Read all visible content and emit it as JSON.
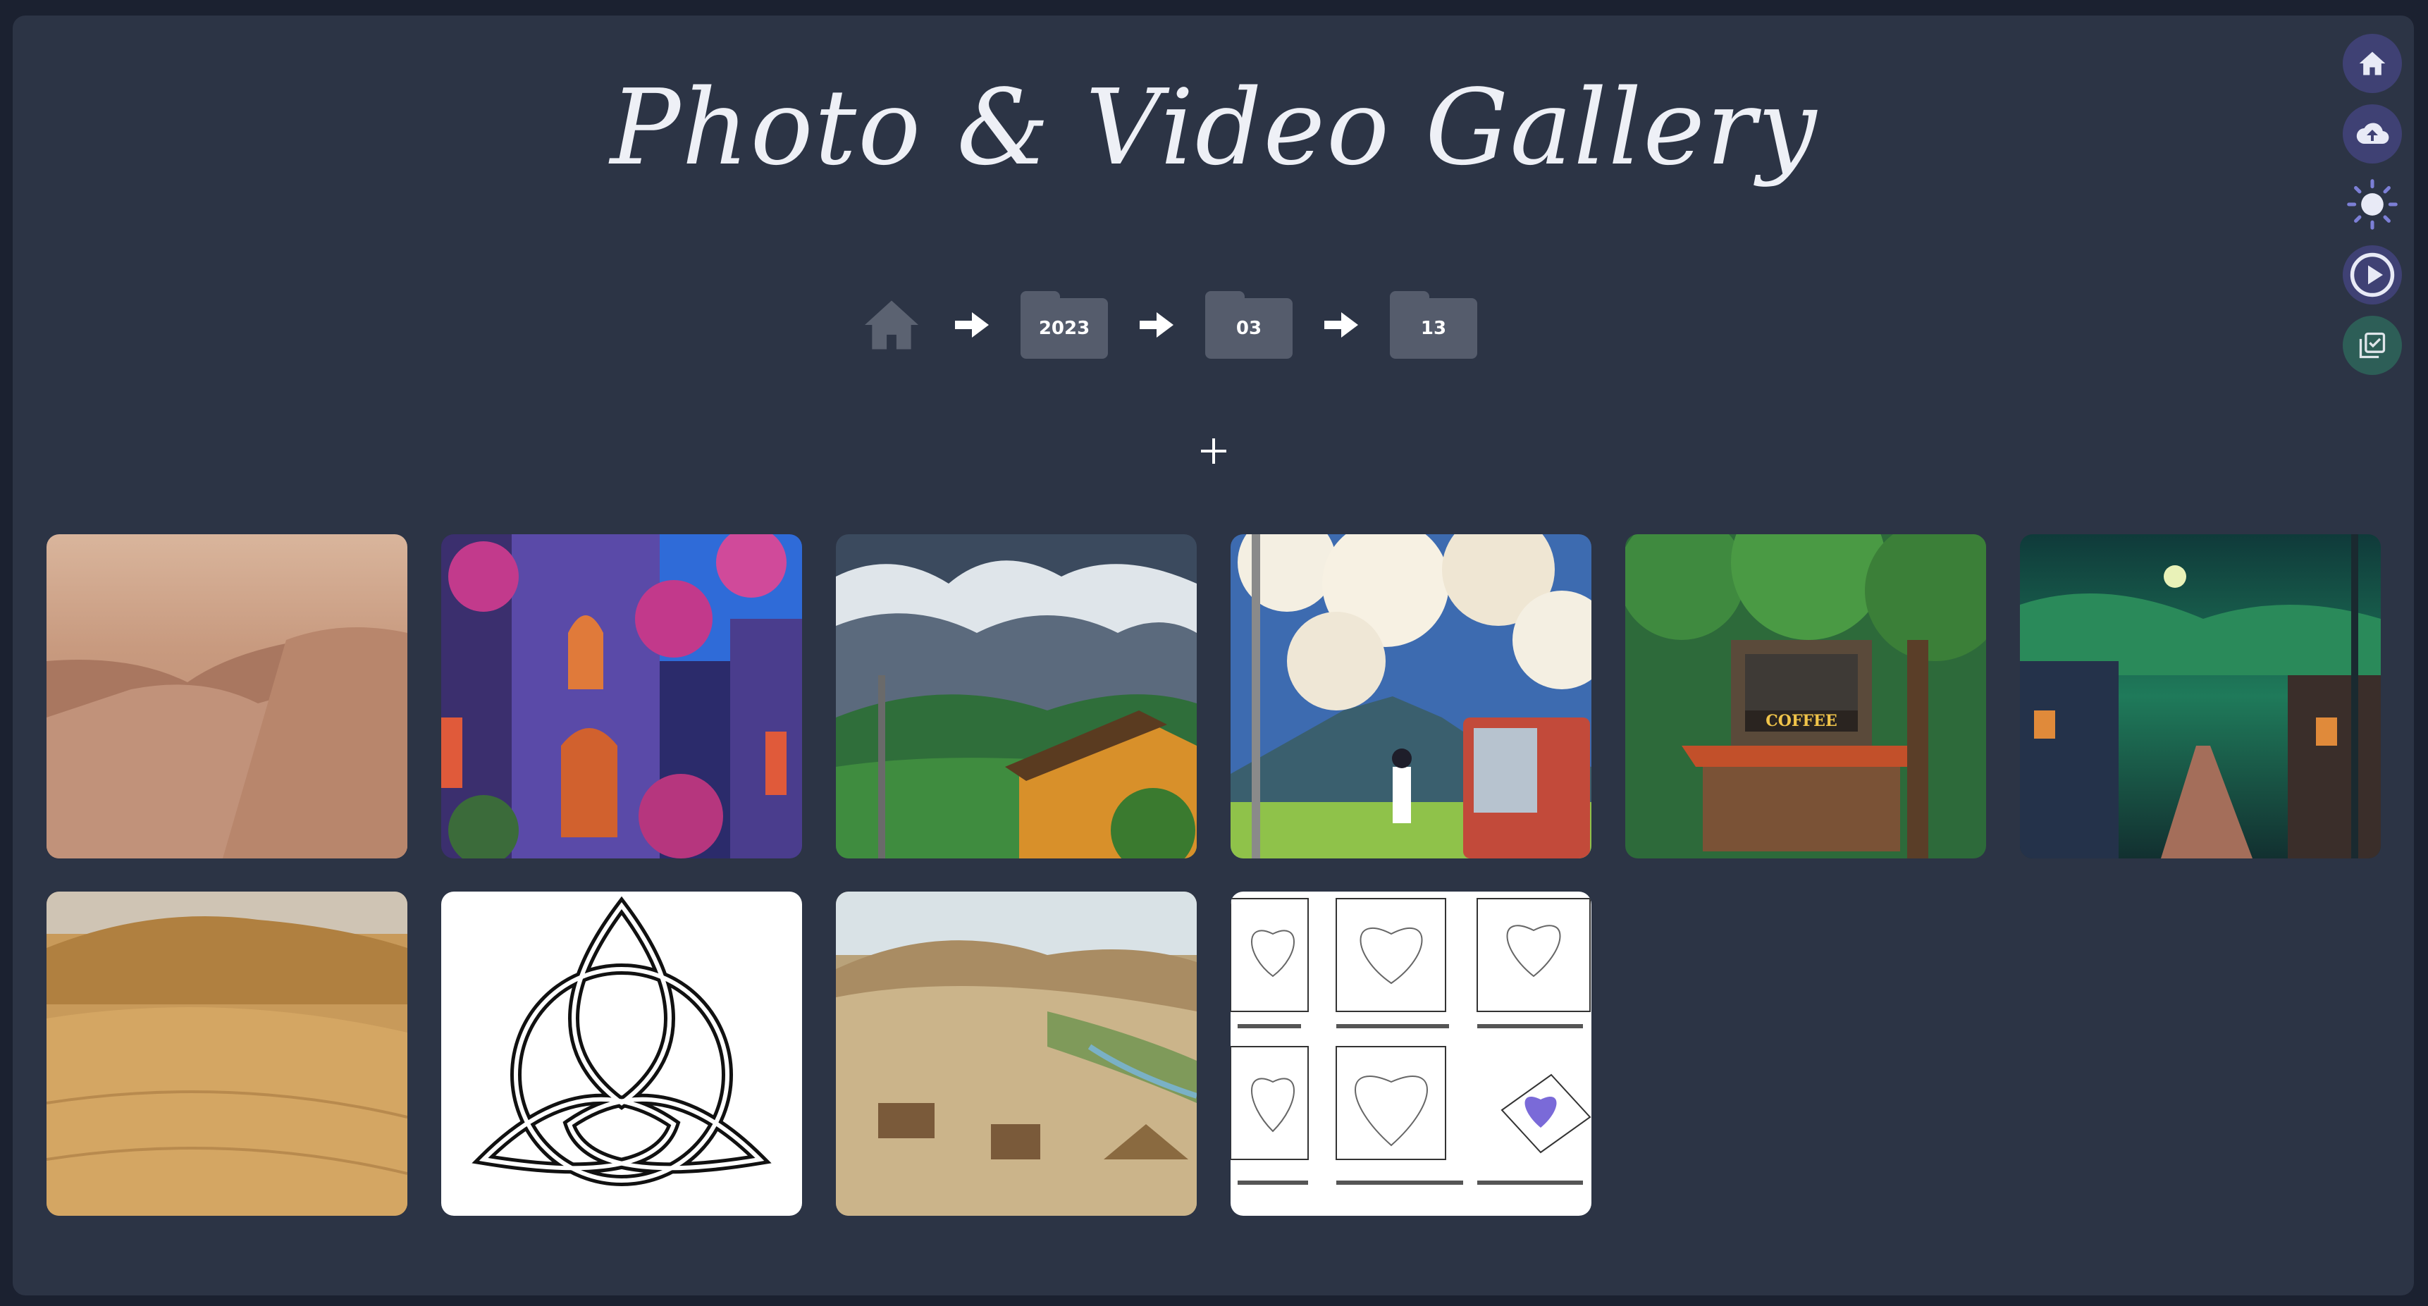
{
  "header": {
    "title": "Photo & Video Gallery"
  },
  "breadcrumb": {
    "home_icon": "home-icon",
    "separator_icon": "arrow-right-icon",
    "folders": [
      {
        "label": "2023"
      },
      {
        "label": "03"
      },
      {
        "label": "13"
      }
    ]
  },
  "toolbar": {
    "actions": [
      {
        "icon": "home-icon"
      },
      {
        "icon": "cloud-upload-icon"
      },
      {
        "icon": "brightness-icon"
      },
      {
        "icon": "play-circle-icon"
      },
      {
        "icon": "select-checkbox-icon"
      }
    ]
  },
  "add_button": {
    "icon": "plus-icon"
  },
  "gallery": {
    "items": [
      {
        "name": "mars-desert",
        "type": "image"
      },
      {
        "name": "flower-alley-night",
        "type": "image"
      },
      {
        "name": "rainy-village",
        "type": "image"
      },
      {
        "name": "clouds-vending-machine",
        "type": "image"
      },
      {
        "name": "coffee-shop",
        "type": "image",
        "sign": "COFFEE"
      },
      {
        "name": "moonlit-street",
        "type": "image"
      },
      {
        "name": "sand-dunes",
        "type": "image"
      },
      {
        "name": "triquetra-knot",
        "type": "image"
      },
      {
        "name": "ancient-settlement",
        "type": "image"
      },
      {
        "name": "heart-equations",
        "type": "image"
      }
    ]
  },
  "colors": {
    "background": "#1b2130",
    "panel": "#2c3445",
    "folder": "#555c6c",
    "accent_button": "#3f4174",
    "select_button": "#2d5e57"
  }
}
